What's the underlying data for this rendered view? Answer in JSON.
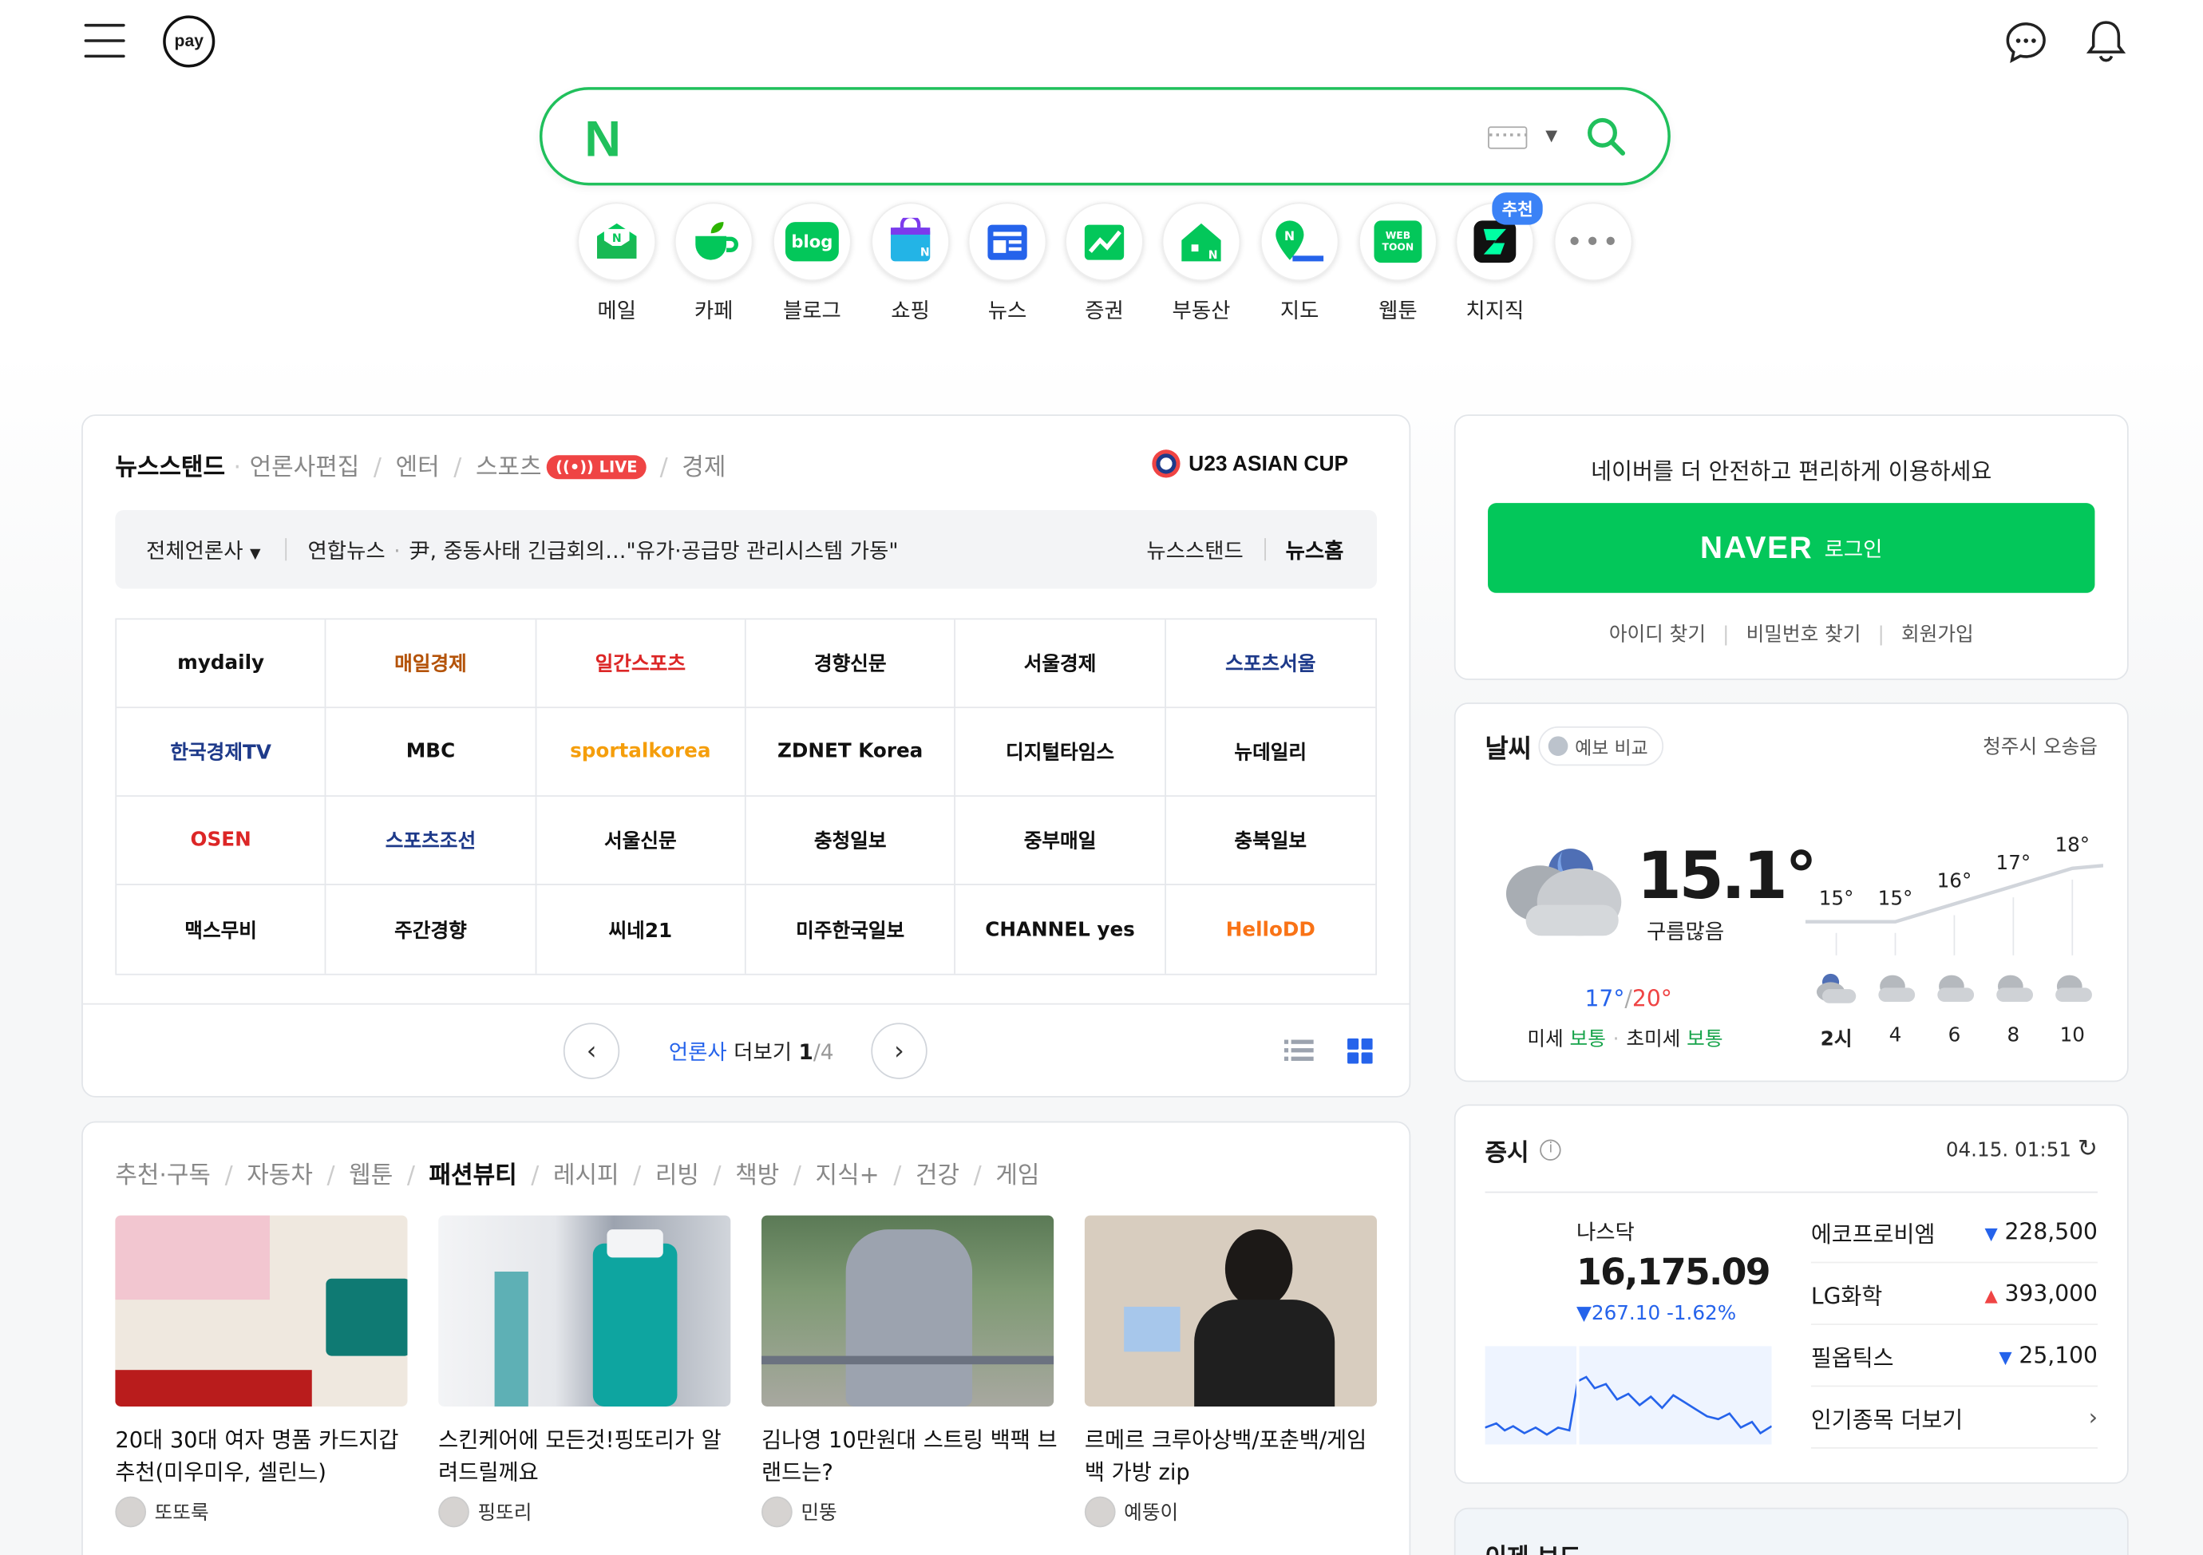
{
  "header": {
    "pay_label": "pay"
  },
  "search": {
    "logo": "N",
    "placeholder": ""
  },
  "shortcuts": [
    {
      "label": "메일",
      "icon": "mail-icon"
    },
    {
      "label": "카페",
      "icon": "cafe-icon"
    },
    {
      "label": "블로그",
      "icon": "blog-icon",
      "text": "blog"
    },
    {
      "label": "쇼핑",
      "icon": "shopping-icon"
    },
    {
      "label": "뉴스",
      "icon": "news-icon"
    },
    {
      "label": "증권",
      "icon": "stock-icon"
    },
    {
      "label": "부동산",
      "icon": "realestate-icon"
    },
    {
      "label": "지도",
      "icon": "map-icon"
    },
    {
      "label": "웹툰",
      "icon": "webtoon-icon",
      "text": "WEB TOON"
    },
    {
      "label": "치지직",
      "icon": "chzzk-icon"
    }
  ],
  "shortcut_badge": "추천",
  "newsstand": {
    "tabs": [
      "뉴스스탠드",
      "언론사편집",
      "엔터",
      "스포츠",
      "경제"
    ],
    "live": "LIVE",
    "sponsor": "U23 ASIAN CUP",
    "all_press": "전체언론사",
    "ticker_source": "연합뉴스",
    "ticker_headline": "尹, 중동사태 긴급회의…\"유가·공급망 관리시스템 가동\"",
    "link_newsstand": "뉴스스탠드",
    "link_newshome": "뉴스홈",
    "press": [
      "mydaily",
      "매일경제",
      "일간스포츠",
      "경향신문",
      "서울경제",
      "스포츠서울",
      "한국경제TV",
      "MBC",
      "sportalkorea",
      "ZDNET Korea",
      "디지털타임스",
      "뉴데일리",
      "OSEN",
      "스포츠조선",
      "서울신문",
      "충청일보",
      "중부매일",
      "충북일보",
      "맥스무비",
      "주간경향",
      "씨네21",
      "미주한국일보",
      "CHANNEL yes",
      "HelloDD"
    ],
    "press_colors": [
      "#111",
      "#b45309",
      "#dc2626",
      "#111",
      "#111",
      "#1e3a8a",
      "#1e3a8a",
      "#111",
      "#f59e0b",
      "#111",
      "#111",
      "#111",
      "#dc2626",
      "#1e3a8a",
      "#111",
      "#111",
      "#111",
      "#111",
      "#111",
      "#111",
      "#111",
      "#111",
      "#111",
      "#f97316"
    ],
    "more_prefix": "언론사",
    "more_suffix": "더보기",
    "page": "1",
    "pages": "/4"
  },
  "content": {
    "tabs": [
      "추천·구독",
      "자동차",
      "웹툰",
      "패션뷰티",
      "레시피",
      "리빙",
      "책방",
      "지식+",
      "건강",
      "게임"
    ],
    "active_tab": "패션뷰티",
    "cards": [
      {
        "title": "20대 30대 여자 명품 카드지갑 추천(미우미우, 셀린느)",
        "author": "또또룩"
      },
      {
        "title": "스킨케어에 모든것!핑또리가 알려드릴께요",
        "author": "핑또리"
      },
      {
        "title": "김나영 10만원대 스트링 백팩 브랜드는?",
        "author": "민뚱"
      },
      {
        "title": "르메르 크루아상백/포춘백/게임백 가방 zip",
        "author": "예뚱이"
      }
    ]
  },
  "login": {
    "headline": "네이버를 더 안전하고 편리하게 이용하세요",
    "brand": "NAVER",
    "button": "로그인",
    "links": [
      "아이디 찾기",
      "비밀번호 찾기",
      "회원가입"
    ]
  },
  "weather": {
    "title": "날씨",
    "compare": "예보 비교",
    "location": "청주시 오송읍",
    "temp": "15.1°",
    "condition": "구름많음",
    "low": "17°",
    "slash": "/",
    "high": "20°",
    "dust_label": "미세",
    "dust": "보통",
    "ultra_label": "초미세",
    "ultra": "보통",
    "hourly": [
      {
        "time": "2시",
        "temp": "15°",
        "value": 15
      },
      {
        "time": "4",
        "temp": "15°",
        "value": 15
      },
      {
        "time": "6",
        "temp": "16°",
        "value": 16
      },
      {
        "time": "8",
        "temp": "17°",
        "value": 17
      },
      {
        "time": "10",
        "temp": "18°",
        "value": 18
      }
    ]
  },
  "stock": {
    "title": "증시",
    "time": "04.15. 01:51",
    "index_name": "나스닥",
    "index_value": "16,175.09",
    "index_change": "▼267.10 -1.62%",
    "items": [
      {
        "name": "에코프로비엠",
        "dir": "▼",
        "price": "228,500",
        "color": "#2563eb"
      },
      {
        "name": "LG화학",
        "dir": "▲",
        "price": "393,000",
        "color": "#ef4444"
      },
      {
        "name": "필옵틱스",
        "dir": "▼",
        "price": "25,100",
        "color": "#2563eb"
      }
    ],
    "more": "인기종목 더보기"
  },
  "issue": {
    "title": "이제 보드"
  }
}
